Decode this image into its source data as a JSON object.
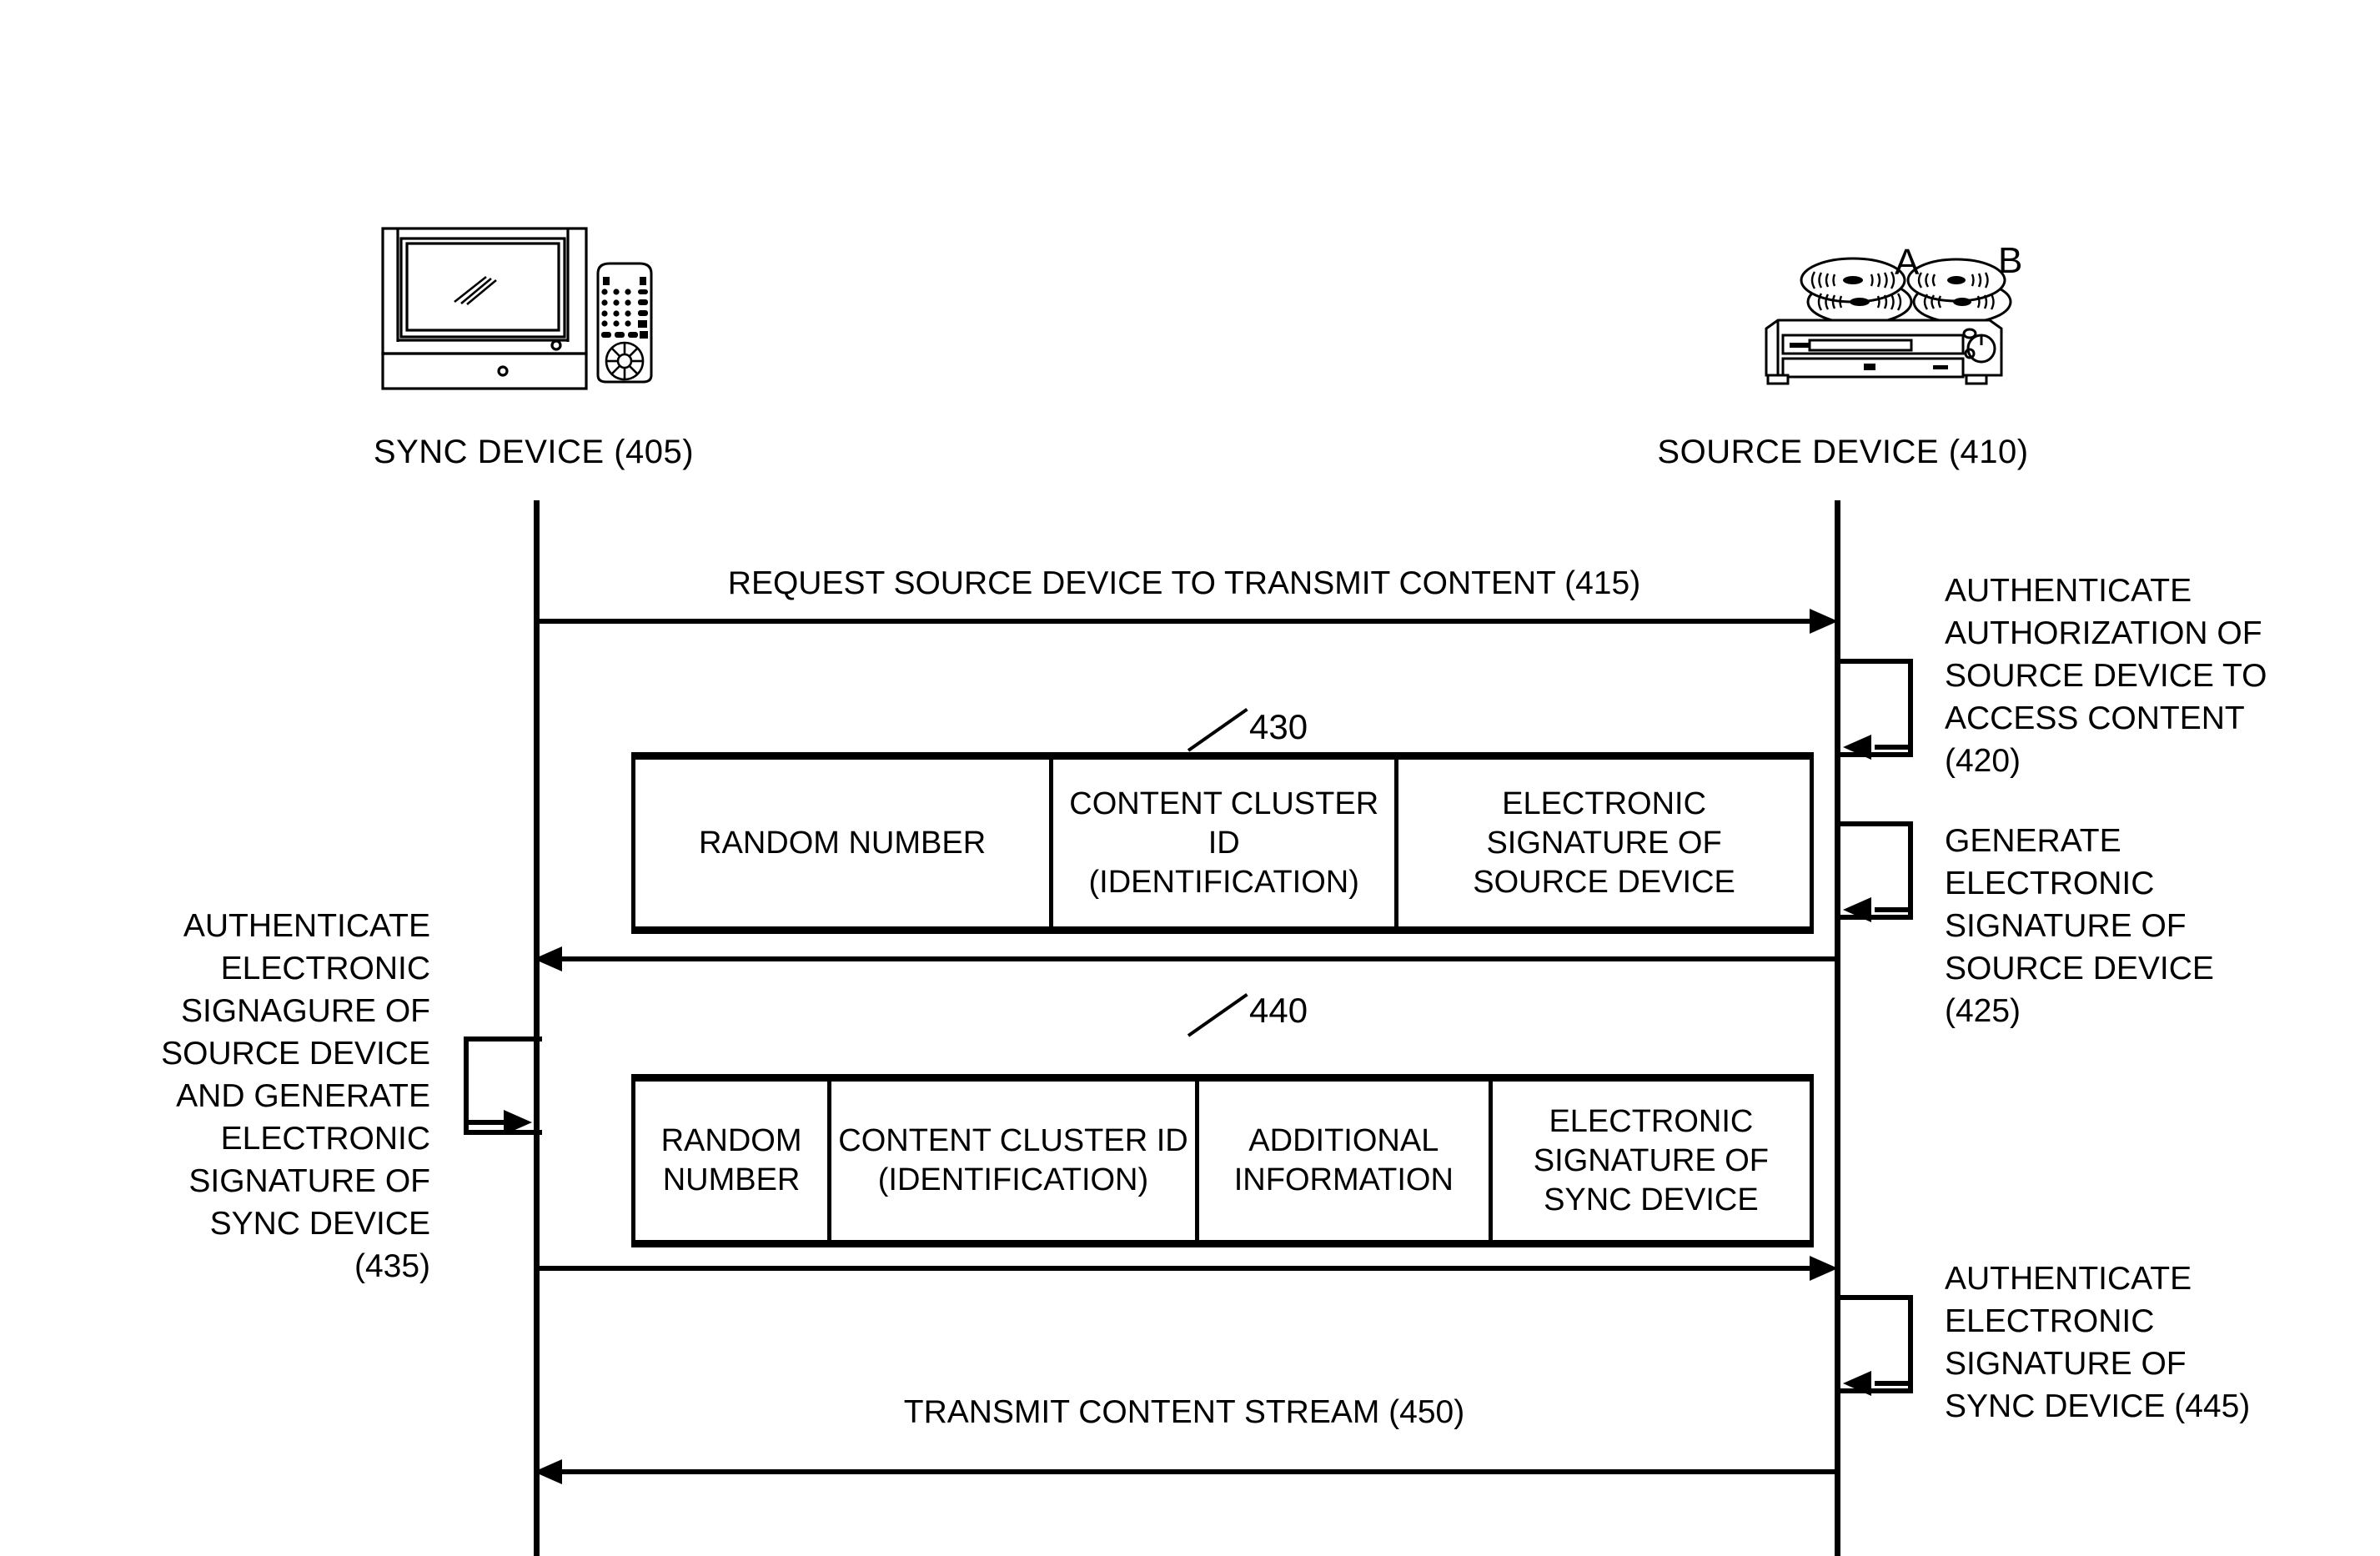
{
  "figure": {
    "type": "sequence-diagram",
    "title": ""
  },
  "actors": [
    {
      "id": "sync",
      "label": "SYNC DEVICE (405)",
      "icon": "television-with-remote-icon"
    },
    {
      "id": "source",
      "label": "SOURCE DEVICE (410)",
      "icon": "disc-player-with-discs-icon",
      "disc_labels": [
        "A",
        "B"
      ]
    }
  ],
  "messages": [
    {
      "ref": "415",
      "label": "REQUEST SOURCE DEVICE TO TRANSMIT CONTENT (415)",
      "direction": "sync-to-source"
    },
    {
      "ref": "430",
      "label": "",
      "direction": "source-to-sync"
    },
    {
      "ref": "440",
      "label": "",
      "direction": "sync-to-source"
    },
    {
      "ref": "450",
      "label": "TRANSMIT CONTENT STREAM (450)",
      "direction": "source-to-sync"
    }
  ],
  "self_actions": [
    {
      "ref": "420",
      "side": "right",
      "text": "AUTHENTICATE\nAUTHORIZATION OF\nSOURCE DEVICE TO\nACCESS CONTENT\n(420)"
    },
    {
      "ref": "425",
      "side": "right",
      "text": "GENERATE\nELECTRONIC\nSIGNATURE OF\nSOURCE DEVICE\n(425)"
    },
    {
      "ref": "435",
      "side": "left",
      "text": "AUTHENTICATE\nELECTRONIC\nSIGNAGURE OF\nSOURCE DEVICE\nAND GENERATE\nELECTRONIC\nSIGNATURE OF\nSYNC DEVICE\n(435)"
    },
    {
      "ref": "445",
      "side": "right",
      "text": "AUTHENTICATE\nELECTRONIC\nSIGNATURE OF\nSYNC DEVICE (445)"
    }
  ],
  "packets": [
    {
      "ref": "430",
      "ref_label": "430",
      "fields": [
        {
          "text": "RANDOM NUMBER",
          "width_pct": 35.6
        },
        {
          "text": "CONTENT CLUSTER ID\n(IDENTIFICATION)",
          "width_pct": 29.4
        },
        {
          "text": "ELECTRONIC\nSIGNATURE OF\nSOURCE DEVICE",
          "width_pct": 35.0
        }
      ]
    },
    {
      "ref": "440",
      "ref_label": "440",
      "fields": [
        {
          "text": "RANDOM\nNUMBER",
          "width_pct": 16.7
        },
        {
          "text": "CONTENT CLUSTER ID\n(IDENTIFICATION)",
          "width_pct": 31.3
        },
        {
          "text": "ADDITIONAL\nINFORMATION",
          "width_pct": 25.0
        },
        {
          "text": "ELECTRONIC\nSIGNATURE OF\nSYNC DEVICE",
          "width_pct": 27.0
        }
      ]
    }
  ],
  "colors": {
    "stroke": "#000000",
    "background": "#ffffff"
  }
}
